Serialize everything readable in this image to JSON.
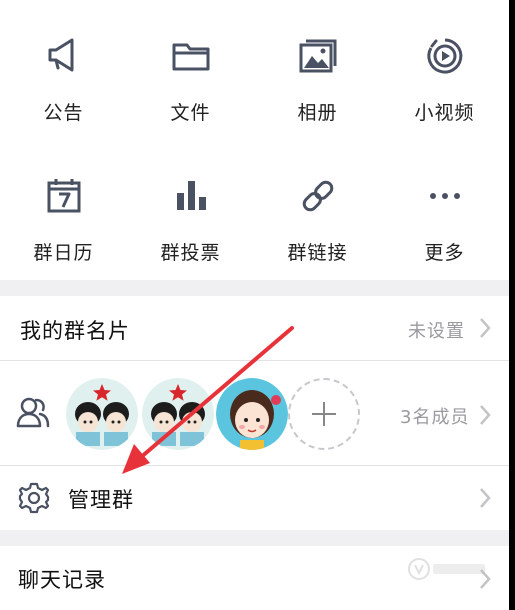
{
  "grid": {
    "items": [
      {
        "label": "公告",
        "icon": "megaphone-icon"
      },
      {
        "label": "文件",
        "icon": "folder-icon"
      },
      {
        "label": "相册",
        "icon": "photo-album-icon"
      },
      {
        "label": "小视频",
        "icon": "video-play-icon"
      },
      {
        "label": "群日历",
        "icon": "calendar-icon"
      },
      {
        "label": "群投票",
        "icon": "bar-chart-icon"
      },
      {
        "label": "群链接",
        "icon": "link-icon"
      },
      {
        "label": "更多",
        "icon": "more-dots-icon"
      }
    ]
  },
  "card": {
    "label": "我的群名片",
    "value": "未设置"
  },
  "members": {
    "count_label": "3名成员",
    "icon": "members-icon"
  },
  "manage": {
    "label": "管理群",
    "icon": "gear-icon"
  },
  "chat": {
    "label": "聊天记录"
  },
  "colors": {
    "icon": "#4a5163",
    "annotation_arrow": "#e8323a",
    "background": "#f0f0f3"
  }
}
